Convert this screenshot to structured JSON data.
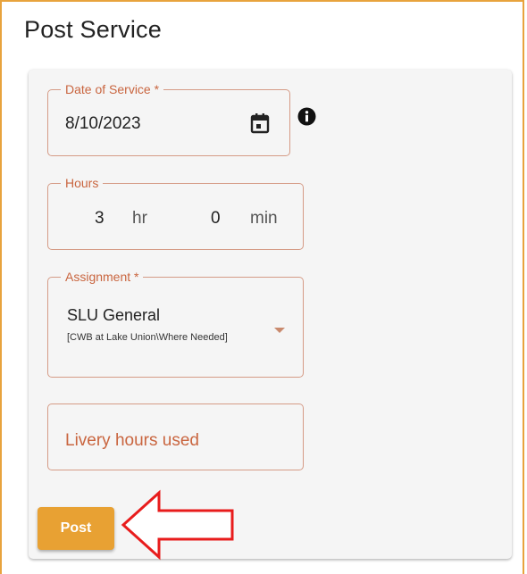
{
  "header": {
    "title": "Post Service"
  },
  "date_field": {
    "legend": "Date of Service *",
    "value": "8/10/2023",
    "icon": "calendar-icon",
    "info_icon": "info-icon"
  },
  "hours_field": {
    "legend": "Hours",
    "hours_value": "3",
    "hours_unit": "hr",
    "minutes_value": "0",
    "minutes_unit": "min"
  },
  "assignment_field": {
    "legend": "Assignment *",
    "selected_primary": "SLU General",
    "selected_secondary": "[CWB at Lake Union\\Where Needed]",
    "icon": "chevron-down-icon"
  },
  "livery_field": {
    "placeholder": "Livery hours used"
  },
  "actions": {
    "post_label": "Post"
  },
  "colors": {
    "accent": "#e8a133",
    "field_border": "#d59b86",
    "label": "#c9653f",
    "annotation_arrow": "#e81c1c"
  }
}
